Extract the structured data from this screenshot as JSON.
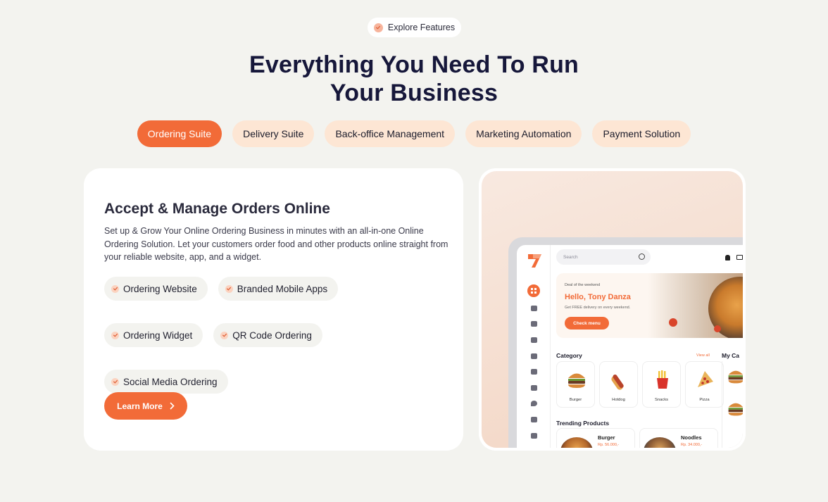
{
  "eyebrow": {
    "label": "Explore Features",
    "icon": "check-icon"
  },
  "headline": {
    "line1": "Everything You Need To Run",
    "line2": "Your Business"
  },
  "tabs": [
    {
      "label": "Ordering Suite",
      "active": true
    },
    {
      "label": "Delivery Suite",
      "active": false
    },
    {
      "label": "Back-office Management",
      "active": false
    },
    {
      "label": "Marketing Automation",
      "active": false
    },
    {
      "label": "Payment Solution",
      "active": false
    }
  ],
  "feature": {
    "title": "Accept & Manage Orders Online",
    "description": "Set up & Grow Your Online Ordering Business in minutes with an all-in-one Online Ordering Solution. Let your customers order food and other products online straight from your reliable website, app, and a widget.",
    "chips": [
      "Ordering Website",
      "Branded Mobile Apps",
      "Ordering Widget",
      "QR Code Ordering",
      "Social Media Ordering"
    ],
    "cta": "Learn More"
  },
  "mockup": {
    "search_placeholder": "Search",
    "banner": {
      "eyebrow": "Deal of the weekend",
      "greeting": "Hello, Tony Danza",
      "subtext": "Get FREE delivery on every weekend.",
      "button": "Check menu"
    },
    "category_title": "Category",
    "view_all": "View all",
    "side_title": "My Ca",
    "categories": [
      "Burger",
      "Hotdog",
      "Snacks",
      "Pizza"
    ],
    "trending_title": "Trending Products",
    "products": [
      {
        "name": "Burger",
        "price": "Rp. 56.000,-"
      },
      {
        "name": "Noodles",
        "price": "Rp. 34.000,-"
      }
    ]
  },
  "colors": {
    "accent": "#f26b38",
    "tab_bg": "#fde6d4",
    "page_bg": "#f3f3ef",
    "heading": "#16173a"
  }
}
